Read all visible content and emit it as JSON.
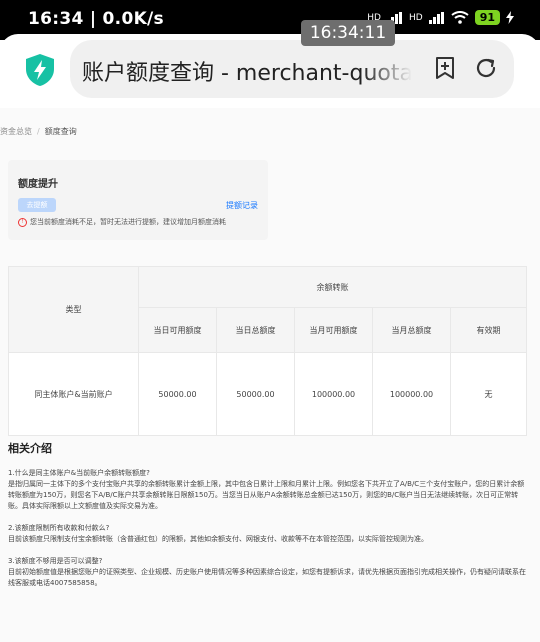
{
  "status_bar": {
    "time": "16:34 | 0.0K/s",
    "net1": "HD",
    "net2": "HD",
    "battery": "91",
    "overlay_time": "16:34:11"
  },
  "browser": {
    "url_text": "账户额度查询 - merchant-quota"
  },
  "breadcrumb": {
    "parent": "资金总览",
    "separator": "/",
    "current": "额度查询"
  },
  "quota_card": {
    "title": "额度提升",
    "withdraw_button": "去提额",
    "withdraw_record_link": "提额记录",
    "warning": "您当前额度消耗不足，暂时无法进行提额，建议增加月额度消耗"
  },
  "table": {
    "type_header": "类型",
    "group_header": "余额转账",
    "columns": [
      "当日可用额度",
      "当日总额度",
      "当月可用额度",
      "当月总额度",
      "有效期"
    ],
    "rows": [
      {
        "type": "同主体账户&当前账户",
        "values": [
          "50000.00",
          "50000.00",
          "100000.00",
          "100000.00",
          "无"
        ]
      }
    ]
  },
  "intro": {
    "title": "相关介绍",
    "faqs": [
      {
        "q": "1.什么是同主体账户&当前账户余额转账额度?",
        "a": "是指归属同一主体下的多个支付宝账户共享的余额转账累计金额上限，其中包含日累计上限和月累计上限。例如您名下共开立了A/B/C三个支付宝账户，您的日累计余额转账额度为150万，则您名下A/B/C账户共享余额转账日限额150万。当您当日从账户A余额转账总金额已达150万，则您的B/C账户当日无法继续转账，次日可正常转账。具体实际限额以上文额度值及实际交易为准。"
      },
      {
        "q": "2.该额度限制所有收款和付款么?",
        "a": "目前该额度只限制支付宝余额转账（含普通红包）的限额，其他如余额支付、网银支付、收款等不在本管控范围，以实际管控规则为准。"
      },
      {
        "q": "3.该额度不够用是否可以调整?",
        "a": "目前初始额度值是根据您账户的证照类型、企业规模、历史账户使用情况等多种因素综合设定，如您有提额诉求，请优先根据页面指引完成相关操作，仍有疑问请联系在线客服或电话4007585858。"
      }
    ]
  },
  "colors": {
    "accent": "#1677ff",
    "button_disabled": "#bcd6fb",
    "warning": "#e33333",
    "shield": "#17c1a4"
  }
}
